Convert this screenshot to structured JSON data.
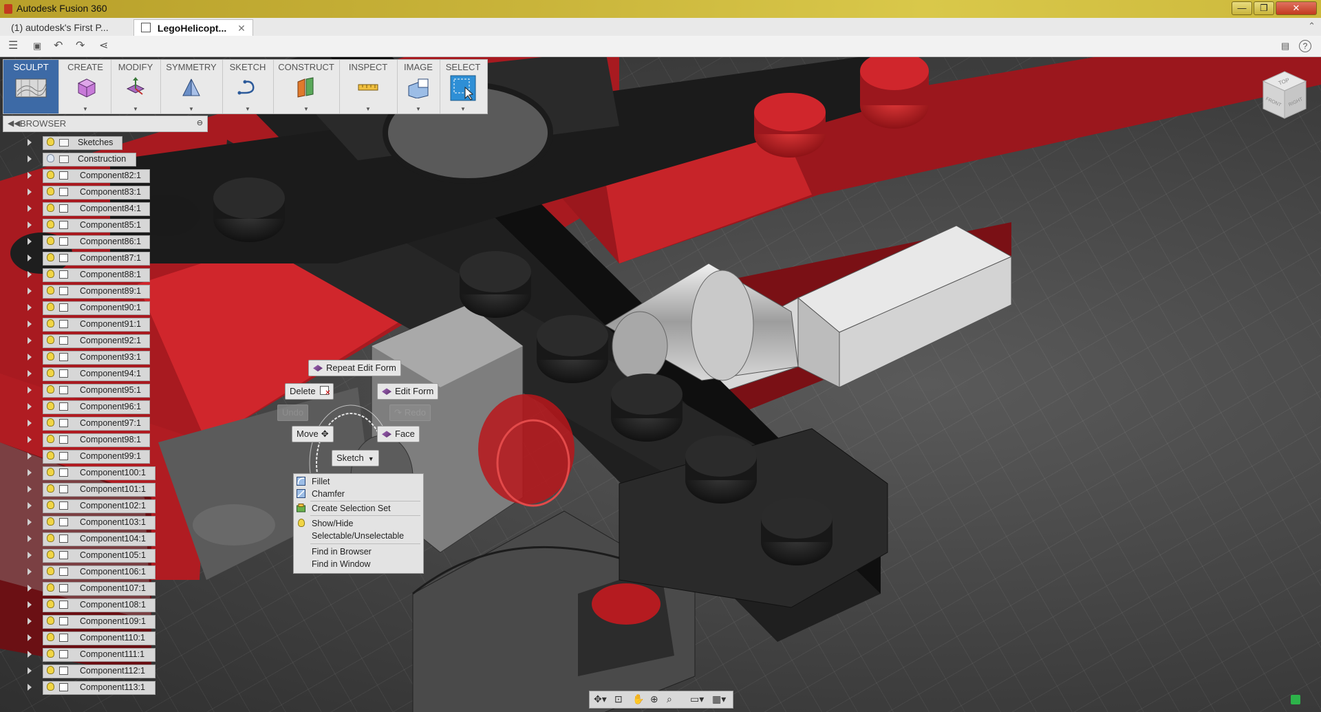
{
  "app": {
    "title": "Autodesk Fusion 360"
  },
  "window_controls": {
    "minimize": "—",
    "maximize": "❐",
    "close": "✕"
  },
  "tabs": [
    {
      "label": "(1) autodesk's First P..."
    },
    {
      "label": "LegoHelicopt...",
      "close": "✕"
    }
  ],
  "quick_access": {
    "menu": "☰",
    "save": "💾",
    "undo": "↶",
    "redo": "↷",
    "share": "⇪",
    "help": "?",
    "comment": "✉"
  },
  "toolbar": {
    "groups": [
      {
        "label": "SCULPT",
        "icon": "sculpt-surface-icon"
      },
      {
        "label": "CREATE",
        "icon": "create-box-icon"
      },
      {
        "label": "MODIFY",
        "icon": "modify-edit-form-icon"
      },
      {
        "label": "SYMMETRY",
        "icon": "symmetry-icon"
      },
      {
        "label": "SKETCH",
        "icon": "sketch-curve-icon"
      },
      {
        "label": "CONSTRUCT",
        "icon": "construct-plane-icon"
      },
      {
        "label": "INSPECT",
        "icon": "inspect-measure-icon"
      },
      {
        "label": "IMAGE",
        "icon": "image-attach-icon"
      },
      {
        "label": "SELECT",
        "icon": "select-arrow-icon"
      }
    ]
  },
  "browser": {
    "title": "BROWSER",
    "collapse": "◀◀",
    "close": "⊖",
    "items": [
      {
        "label": "Sketches",
        "kind": "folder"
      },
      {
        "label": "Construction",
        "kind": "folder"
      },
      {
        "label": "Component82:1",
        "kind": "component"
      },
      {
        "label": "Component83:1",
        "kind": "component"
      },
      {
        "label": "Component84:1",
        "kind": "component"
      },
      {
        "label": "Component85:1",
        "kind": "component"
      },
      {
        "label": "Component86:1",
        "kind": "component"
      },
      {
        "label": "Component87:1",
        "kind": "component"
      },
      {
        "label": "Component88:1",
        "kind": "component"
      },
      {
        "label": "Component89:1",
        "kind": "component"
      },
      {
        "label": "Component90:1",
        "kind": "component"
      },
      {
        "label": "Component91:1",
        "kind": "component"
      },
      {
        "label": "Component92:1",
        "kind": "component"
      },
      {
        "label": "Component93:1",
        "kind": "component"
      },
      {
        "label": "Component94:1",
        "kind": "component"
      },
      {
        "label": "Component95:1",
        "kind": "component"
      },
      {
        "label": "Component96:1",
        "kind": "component"
      },
      {
        "label": "Component97:1",
        "kind": "component"
      },
      {
        "label": "Component98:1",
        "kind": "component"
      },
      {
        "label": "Component99:1",
        "kind": "component"
      },
      {
        "label": "Component100:1",
        "kind": "component"
      },
      {
        "label": "Component101:1",
        "kind": "component"
      },
      {
        "label": "Component102:1",
        "kind": "component"
      },
      {
        "label": "Component103:1",
        "kind": "component"
      },
      {
        "label": "Component104:1",
        "kind": "component"
      },
      {
        "label": "Component105:1",
        "kind": "component"
      },
      {
        "label": "Component106:1",
        "kind": "component"
      },
      {
        "label": "Component107:1",
        "kind": "component"
      },
      {
        "label": "Component108:1",
        "kind": "component"
      },
      {
        "label": "Component109:1",
        "kind": "component"
      },
      {
        "label": "Component110:1",
        "kind": "component"
      },
      {
        "label": "Component111:1",
        "kind": "component"
      },
      {
        "label": "Component112:1",
        "kind": "component"
      },
      {
        "label": "Component113:1",
        "kind": "component"
      }
    ]
  },
  "marking_menu": {
    "repeat": "Repeat Edit Form",
    "delete": "Delete",
    "edit_form": "Edit Form",
    "undo": "Undo",
    "redo": "Redo",
    "move": "Move",
    "face": "Face",
    "sketch": "Sketch"
  },
  "context_menu": {
    "items": [
      {
        "label": "Fillet",
        "icon": "fillet-icon"
      },
      {
        "label": "Chamfer",
        "icon": "chamfer-icon"
      },
      {
        "label": "Create Selection Set",
        "icon": "selection-set-icon"
      },
      {
        "label": "Show/Hide",
        "icon": "lightbulb-icon"
      },
      {
        "label": "Selectable/Unselectable",
        "icon": ""
      },
      {
        "label": "Find in Browser",
        "icon": ""
      },
      {
        "label": "Find in Window",
        "icon": ""
      }
    ]
  },
  "viewcube": {
    "top": "TOP",
    "front": "FRONT",
    "right": "RIGHT"
  },
  "colors": {
    "accent": "#3d6aa6",
    "lego_red": "#b21d22",
    "lego_black": "#1c1c1c"
  }
}
